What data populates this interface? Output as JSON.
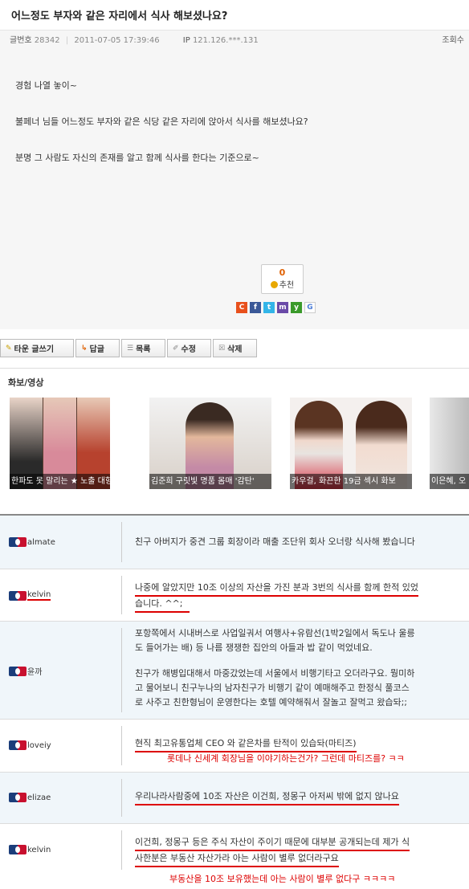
{
  "post": {
    "title": "어느정도 부자와 같은 자리에서 식사 해보셨나요?",
    "num_label": "글번호",
    "num": "28342",
    "datetime": "2011-07-05 17:39:46",
    "ip_label": "IP",
    "ip": "121.126.***.131",
    "views_label": "조회수",
    "paragraphs": [
      "경험 나열 놓이~",
      "불페너 님들 어느정도 부자와 같은 식당 같은 자리에 앉아서 식사를 해보셨나요?",
      "분명 그 사람도 자신의 존재를 알고 함께 식사를 한다는 기준으로~"
    ],
    "recommend_count": "0",
    "recommend_label": "추천"
  },
  "share": [
    {
      "icon": "cyworld-c-icon",
      "glyph": "C",
      "color": "#e8501c"
    },
    {
      "icon": "facebook-icon",
      "glyph": "f",
      "color": "#3b5998"
    },
    {
      "icon": "twitter-icon",
      "glyph": "t",
      "color": "#33b5e8"
    },
    {
      "icon": "me2day-icon",
      "glyph": "m",
      "color": "#6a4aa8"
    },
    {
      "icon": "yozm-icon",
      "glyph": "y",
      "color": "#3a9a2a"
    },
    {
      "icon": "google-icon",
      "glyph": "G",
      "color": "#ffffff"
    }
  ],
  "buttons": {
    "write": "타운 글쓰기",
    "reply": "답글",
    "list": "목록",
    "edit": "수정",
    "delete": "삭제"
  },
  "photo": {
    "heading": "화보/영상",
    "items": [
      {
        "caption": "한파도 못 말리는 ★ 노출 대향연"
      },
      {
        "caption": "김준희 구릿빛 명품 몸매 '감탄'"
      },
      {
        "caption": "카우걸, 화끈한 19금 섹시 화보"
      },
      {
        "caption": "이은혜, 오"
      }
    ]
  },
  "comments": [
    {
      "user": "almate",
      "lines": [
        "친구 아버지가 중견 그룹 회장이라 매출 조단위 회사 오너랑 식사해 봤습니다"
      ]
    },
    {
      "user": "kelvin",
      "lines": [
        "나중에 알았지만 10조 이상의 자산을 가진 분과 3번의 식사를 함께 한적 있었",
        "습니다. ^^;"
      ]
    },
    {
      "user": "윤까",
      "lines": [
        "포항쪽에서 시내버스로 사업일궈서 여행사+유람선(1박2일에서 독도나 울릉",
        "도 들어가는 배) 등 나름 쟁쟁한 집안의 아들과 밥 같이 먹었네요.",
        "",
        "친구가 해병입대해서 마중갔었는데 서울에서 비행기타고 오더라구요. 뭥미하",
        "고 물어보니 친구누나의 남자친구가 비행기 같이 예매해주고 한정식 풀코스",
        "로 사주고 친한형님이 운영한다는 호텔 예약해줘서 잘놀고 잘먹고 왔습돠;;"
      ]
    },
    {
      "user": "loveiy",
      "lines": [
        "현직 최고유통업체 CEO 와 같은차를 탄적이 있습돠(마티즈)"
      ],
      "note": "롯데나 신세계 회장님을 이야기하는건가? 그런데 마티즈를? ㅋㅋ"
    },
    {
      "user": "elizae",
      "lines": [
        "우리나라사람중에 10조 자산은 이건희, 정몽구 아저씨 밖에 없지 않나요"
      ]
    },
    {
      "user": "kelvin",
      "lines": [
        "이건희, 정몽구 등은 주식 자산이 주이기 때문에 대부분 공개되는데 제가 식",
        "사한분은 부동산 자산가라 아는 사람이 별루 없더라구요"
      ],
      "note": "부동산을 10조 보유했는데 아는 사람이 별루 없다구 ㅋㅋㅋㅋ"
    }
  ]
}
